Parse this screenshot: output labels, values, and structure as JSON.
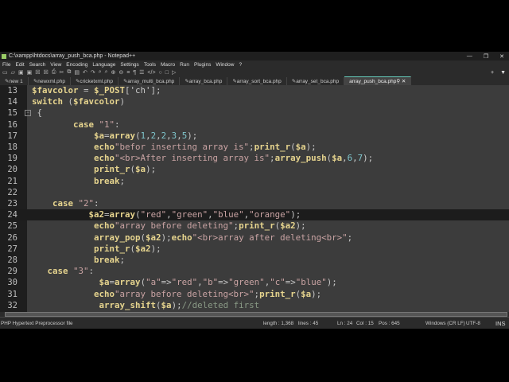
{
  "title": "C:\\xampp\\htdocs\\array_push_bca.php - Notepad++",
  "window_controls": [
    "—",
    "❐",
    "✕"
  ],
  "menu": [
    "File",
    "Edit",
    "Search",
    "View",
    "Encoding",
    "Language",
    "Settings",
    "Tools",
    "Macro",
    "Run",
    "Plugins",
    "Window",
    "?"
  ],
  "tabs": [
    {
      "label": "new 1",
      "active": false
    },
    {
      "label": "newxml.php",
      "active": false
    },
    {
      "label": "cricketxml.php",
      "active": false
    },
    {
      "label": "array_multi_bca.php",
      "active": false
    },
    {
      "label": "array_bca.php",
      "active": false
    },
    {
      "label": "array_sort_bca.php",
      "active": false
    },
    {
      "label": "array_set_bca.php",
      "active": false
    },
    {
      "label": "array_push_bca.php",
      "active": true
    }
  ],
  "tab_extras": {
    "add": "+",
    "list": "▼"
  },
  "current_line": 24,
  "lines": [
    {
      "n": "13",
      "t": [
        [
          "$favcolor",
          "v"
        ],
        [
          " = ",
          "p"
        ],
        [
          "$_POST",
          "v"
        ],
        [
          "['ch'];",
          "p"
        ]
      ]
    },
    {
      "n": "14",
      "t": [
        [
          "switch",
          "k"
        ],
        [
          " (",
          "p"
        ],
        [
          "$favcolor",
          "v"
        ],
        [
          ")",
          "p"
        ]
      ]
    },
    {
      "n": "15",
      "t": [
        [
          " {",
          "p"
        ]
      ]
    },
    {
      "n": "16",
      "t": [
        [
          "        ",
          "p"
        ],
        [
          "case",
          "k"
        ],
        [
          " \"1\"",
          "s"
        ],
        [
          ":",
          "p"
        ]
      ]
    },
    {
      "n": "17",
      "t": [
        [
          "            ",
          "p"
        ],
        [
          "$a",
          "v"
        ],
        [
          "=",
          "p"
        ],
        [
          "array",
          "k"
        ],
        [
          "(",
          "p"
        ],
        [
          "1",
          "n"
        ],
        [
          ",",
          "p"
        ],
        [
          "2",
          "n"
        ],
        [
          ",",
          "p"
        ],
        [
          "2",
          "n"
        ],
        [
          ",",
          "p"
        ],
        [
          "3",
          "n"
        ],
        [
          ",",
          "p"
        ],
        [
          "5",
          "n"
        ],
        [
          ");",
          "p"
        ]
      ]
    },
    {
      "n": "18",
      "t": [
        [
          "            ",
          "p"
        ],
        [
          "echo",
          "k"
        ],
        [
          "\"befor inserting array is\"",
          "s"
        ],
        [
          ";",
          "p"
        ],
        [
          "print_r",
          "k"
        ],
        [
          "(",
          "p"
        ],
        [
          "$a",
          "v"
        ],
        [
          ");",
          "p"
        ]
      ]
    },
    {
      "n": "19",
      "t": [
        [
          "            ",
          "p"
        ],
        [
          "echo",
          "k"
        ],
        [
          "\"<br>After inserting array is\"",
          "s"
        ],
        [
          ";",
          "p"
        ],
        [
          "array_push",
          "k"
        ],
        [
          "(",
          "p"
        ],
        [
          "$a",
          "v"
        ],
        [
          ",",
          "p"
        ],
        [
          "6",
          "n"
        ],
        [
          ",",
          "p"
        ],
        [
          "7",
          "n"
        ],
        [
          ");",
          "p"
        ]
      ]
    },
    {
      "n": "20",
      "t": [
        [
          "            ",
          "p"
        ],
        [
          "print_r",
          "k"
        ],
        [
          "(",
          "p"
        ],
        [
          "$a",
          "v"
        ],
        [
          ");",
          "p"
        ]
      ]
    },
    {
      "n": "21",
      "t": [
        [
          "            ",
          "p"
        ],
        [
          "break",
          "k"
        ],
        [
          ";",
          "p"
        ]
      ]
    },
    {
      "n": "22",
      "t": []
    },
    {
      "n": "23",
      "t": [
        [
          "    ",
          "p"
        ],
        [
          "case",
          "k"
        ],
        [
          " \"2\"",
          "s"
        ],
        [
          ":",
          "p"
        ]
      ]
    },
    {
      "n": "24",
      "t": [
        [
          "           ",
          "p"
        ],
        [
          "$a2",
          "v"
        ],
        [
          "=",
          "p"
        ],
        [
          "array",
          "k"
        ],
        [
          "(",
          "p"
        ],
        [
          "\"red\"",
          "s"
        ],
        [
          ",",
          "p"
        ],
        [
          "\"green\"",
          "s"
        ],
        [
          ",",
          "p"
        ],
        [
          "\"blue\"",
          "s"
        ],
        [
          ",",
          "p"
        ],
        [
          "\"orange\"",
          "s"
        ],
        [
          ");",
          "p"
        ]
      ]
    },
    {
      "n": "25",
      "t": [
        [
          "            ",
          "p"
        ],
        [
          "echo",
          "k"
        ],
        [
          "\"array before deleting\"",
          "s"
        ],
        [
          ";",
          "p"
        ],
        [
          "print_r",
          "k"
        ],
        [
          "(",
          "p"
        ],
        [
          "$a2",
          "v"
        ],
        [
          ");",
          "p"
        ]
      ]
    },
    {
      "n": "26",
      "t": [
        [
          "            ",
          "p"
        ],
        [
          "array_pop",
          "k"
        ],
        [
          "(",
          "p"
        ],
        [
          "$a2",
          "v"
        ],
        [
          ");",
          "p"
        ],
        [
          "echo",
          "k"
        ],
        [
          "\"<br>array after deleting<br>\"",
          "s"
        ],
        [
          ";",
          "p"
        ]
      ]
    },
    {
      "n": "27",
      "t": [
        [
          "            ",
          "p"
        ],
        [
          "print_r",
          "k"
        ],
        [
          "(",
          "p"
        ],
        [
          "$a2",
          "v"
        ],
        [
          ");",
          "p"
        ]
      ]
    },
    {
      "n": "28",
      "t": [
        [
          "            ",
          "p"
        ],
        [
          "break",
          "k"
        ],
        [
          ";",
          "p"
        ]
      ]
    },
    {
      "n": "29",
      "t": [
        [
          "   ",
          "p"
        ],
        [
          "case",
          "k"
        ],
        [
          " \"3\"",
          "s"
        ],
        [
          ":",
          "p"
        ]
      ]
    },
    {
      "n": "30",
      "t": [
        [
          "             ",
          "p"
        ],
        [
          "$a",
          "v"
        ],
        [
          "=",
          "p"
        ],
        [
          "array",
          "k"
        ],
        [
          "(",
          "p"
        ],
        [
          "\"a\"",
          "s"
        ],
        [
          "=>",
          "p"
        ],
        [
          "\"red\"",
          "s"
        ],
        [
          ",",
          "p"
        ],
        [
          "\"b\"",
          "s"
        ],
        [
          "=>",
          "p"
        ],
        [
          "\"green\"",
          "s"
        ],
        [
          ",",
          "p"
        ],
        [
          "\"c\"",
          "s"
        ],
        [
          "=>",
          "p"
        ],
        [
          "\"blue\"",
          "s"
        ],
        [
          ");",
          "p"
        ]
      ]
    },
    {
      "n": "31",
      "t": [
        [
          "            ",
          "p"
        ],
        [
          "echo",
          "k"
        ],
        [
          "\"array before deleting<br>\"",
          "s"
        ],
        [
          ";",
          "p"
        ],
        [
          "print_r",
          "k"
        ],
        [
          "(",
          "p"
        ],
        [
          "$a",
          "v"
        ],
        [
          ");",
          "p"
        ]
      ]
    },
    {
      "n": "32",
      "t": [
        [
          "             ",
          "p"
        ],
        [
          "array_shift",
          "k"
        ],
        [
          "(",
          "p"
        ],
        [
          "$a",
          "v"
        ],
        [
          ");",
          "p"
        ],
        [
          "//deleted first",
          "c"
        ]
      ]
    }
  ],
  "status": {
    "file_type": "PHP Hypertext Preprocessor file",
    "length": "length : 1,368",
    "lines": "lines : 45",
    "ln": "Ln : 24",
    "col": "Col : 15",
    "pos": "Pos : 645",
    "eol": "Windows (CR LF)",
    "encoding": "UTF-8",
    "mode": "INS"
  }
}
